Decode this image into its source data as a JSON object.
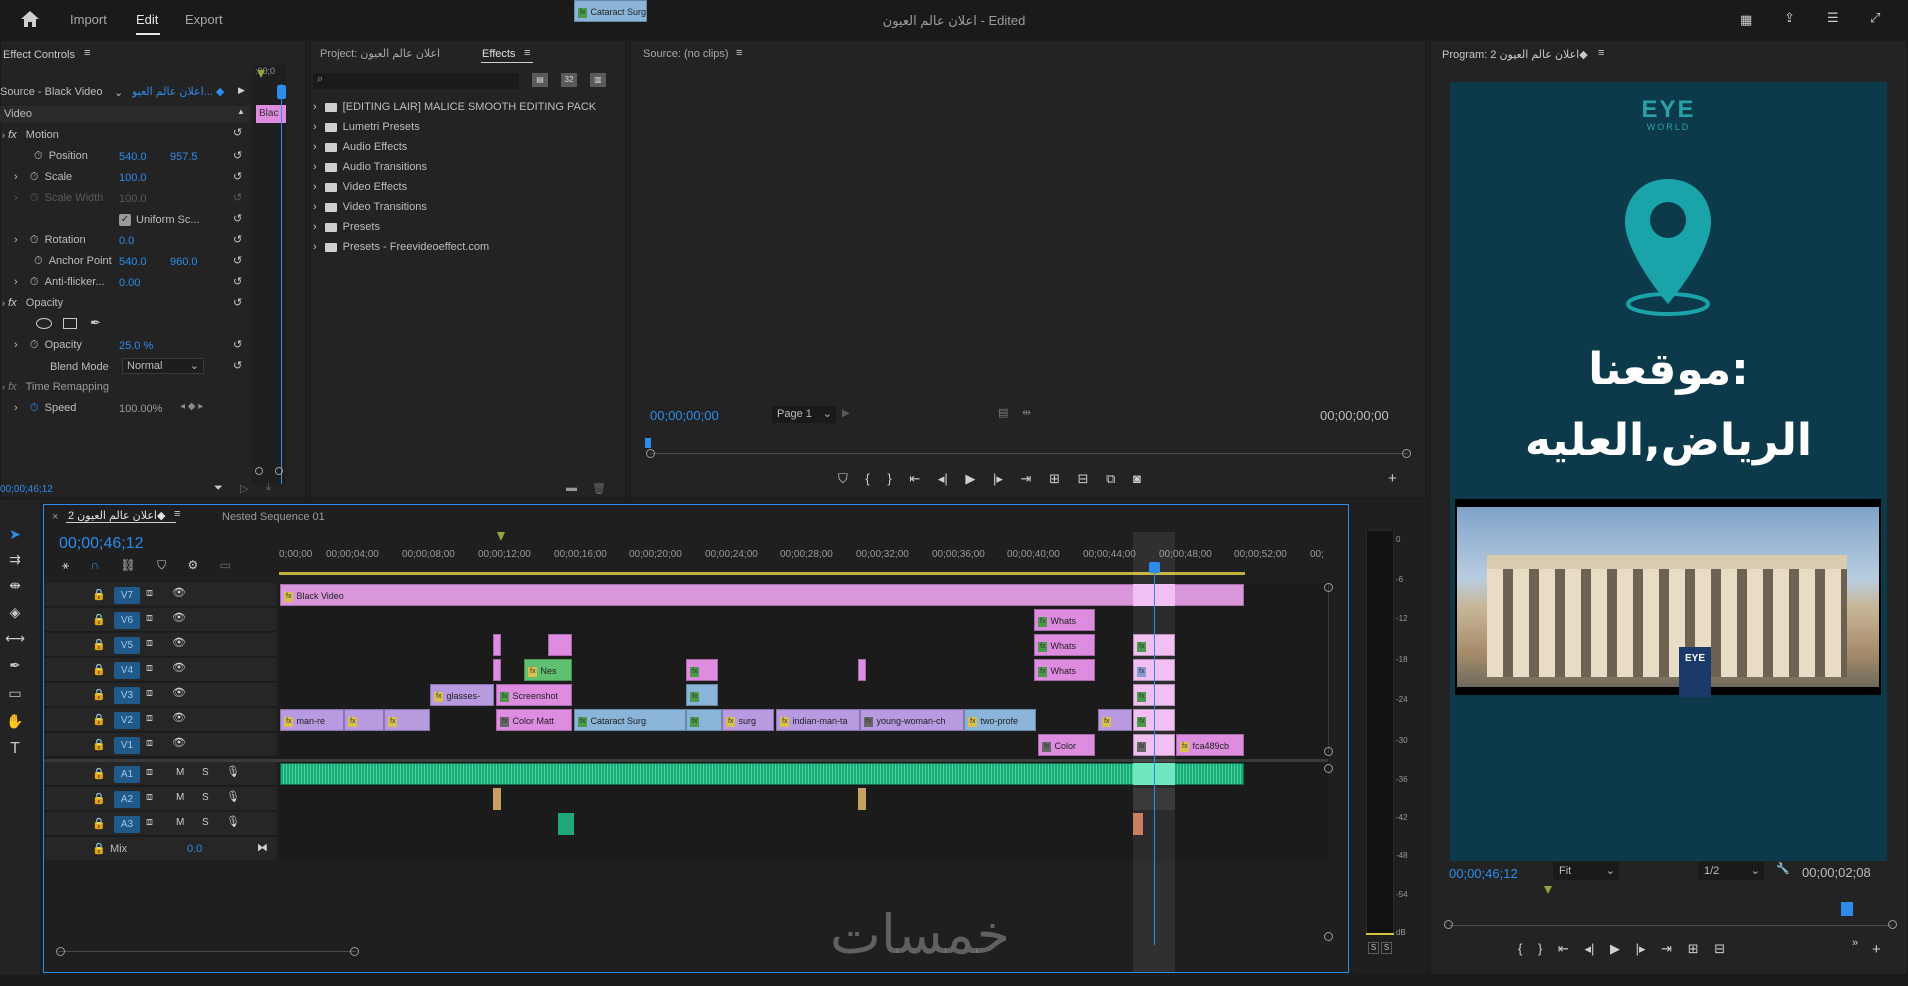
{
  "topbar": {
    "tabs": [
      "Import",
      "Edit",
      "Export"
    ],
    "title": "اعلان عالم العيون - Edited"
  },
  "effect_controls": {
    "title": "Effect Controls",
    "source": "Source - Black Video",
    "sequence": "اعلان عالم العيو... ◆",
    "clip_label": "Blac",
    "timecode_small": ":00;0",
    "video_header": "Video",
    "motion": "Motion",
    "position_label": "Position",
    "position_x": "540.0",
    "position_y": "957.5",
    "scale_label": "Scale",
    "scale": "100.0",
    "scale_width_label": "Scale Width",
    "scale_width": "100.0",
    "uniform": "Uniform Sc...",
    "rotation_label": "Rotation",
    "rotation": "0.0",
    "anchor_label": "Anchor Point",
    "anchor_x": "540.0",
    "anchor_y": "960.0",
    "antiflicker_label": "Anti-flicker...",
    "antiflicker": "0.00",
    "opacity_header": "Opacity",
    "opacity_label": "Opacity",
    "opacity": "25.0 %",
    "blend_label": "Blend Mode",
    "blend": "Normal",
    "time_remap": "Time Remapping",
    "speed_label": "Speed",
    "speed": "100.00%",
    "bottom_timecode": "00;00;46;12"
  },
  "project": {
    "tab_project": "Project: اعلان عالم العيون",
    "tab_effects": "Effects",
    "search_placeholder": "",
    "items": [
      "[EDITING LAIR] MALICE SMOOTH EDITING PACK",
      "Lumetri Presets",
      "Audio Effects",
      "Audio Transitions",
      "Video Effects",
      "Video Transitions",
      "Presets",
      "Presets - Freevideoeffect.com"
    ]
  },
  "source": {
    "title": "Source: (no clips)",
    "timecode_left": "00;00;00;00",
    "page": "Page 1",
    "timecode_right": "00;00;00;00"
  },
  "program": {
    "title": "Program: اعلان عالم العيون 2◆",
    "timecode_left": "00;00;46;12",
    "fit": "Fit",
    "resolution": "1/2",
    "timecode_right": "00;00;02;08",
    "logo_top": "EYE",
    "logo_sub": "WORLD",
    "headline1": "موقعنا:",
    "headline2": "الرياض,العليه",
    "building_sign": "EYE"
  },
  "timeline": {
    "tab_active": "اعلان عالم العيون 2◆",
    "tab_other": "Nested Sequence 01",
    "timecode": "00;00;46;12",
    "ruler": [
      "0;00;00",
      "00;00;04;00",
      "00;00;08;00",
      "00;00;12;00",
      "00;00;16;00",
      "00;00;20;00",
      "00;00;24;00",
      "00;00;28;00",
      "00;00;32;00",
      "00;00;36;00",
      "00;00;40;00",
      "00;00;44;00",
      "00;00;48;00",
      "00;00;52;00",
      "00;"
    ],
    "video_tracks": [
      "V7",
      "V6",
      "V5",
      "V4",
      "V3",
      "V2",
      "V1"
    ],
    "audio_tracks": [
      "A1",
      "A2",
      "A3"
    ],
    "mix_label": "Mix",
    "mix_value": "0.0",
    "clips": {
      "black_video": "Black Video",
      "whats": "Whats",
      "nes": "Nes",
      "glasses": "glasses-",
      "screenshot": "Screenshot",
      "cataract1": "Cataract Surg",
      "cataract2": "Cataract Surg",
      "man": "man-re",
      "color_matt": "Color Matt",
      "surg": "surg",
      "indian": "indian-man-ta",
      "young": "young-woman-ch",
      "two": "two-profe",
      "color": "Color",
      "fca": "fca489cb"
    }
  },
  "meter": {
    "labels": [
      "0",
      "-6",
      "-12",
      "-18",
      "-24",
      "-30",
      "-36",
      "-42",
      "-48",
      "-54",
      "dB"
    ],
    "solo": "S"
  },
  "watermark": "خمسات"
}
